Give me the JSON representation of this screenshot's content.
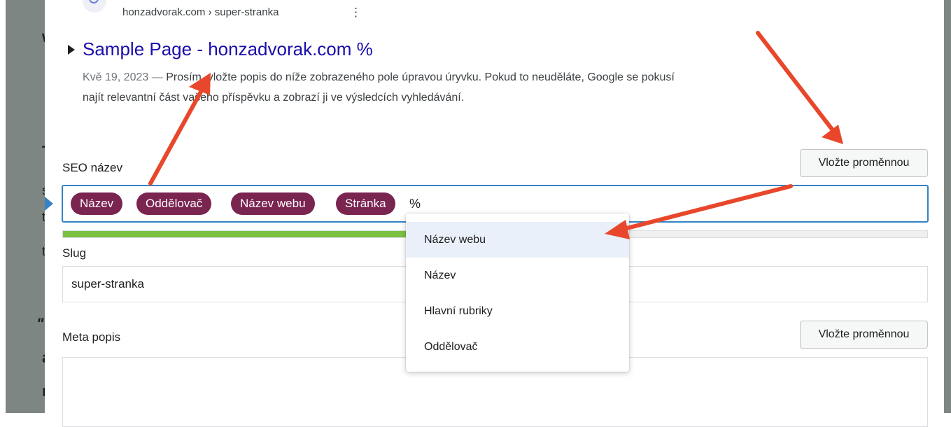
{
  "background_fragments": [
    "w",
    "T",
    "s",
    "t",
    "t",
    "\"",
    "a",
    "r"
  ],
  "preview": {
    "breadcrumb": "honzadvorak.com › super-stranka",
    "kebab": "⋮",
    "title": "Sample Page - honzadvorak.com %",
    "date": "Kvě 19, 2023 — ",
    "description": "Prosím, vložte popis do níže zobrazeného pole úpravou úryvku. Pokud to neuděláte, Google se pokusí najít relevantní část vašeho příspěvku a zobrazí ji ve výsledcích vyhledávání."
  },
  "seo_title": {
    "label": "SEO název",
    "insert_button": "Vložte proměnnou",
    "pills": [
      "Název",
      "Oddělovač",
      "Název webu",
      "Stránka"
    ],
    "trailing_text": "%",
    "progress": 0.4
  },
  "slug": {
    "label": "Slug",
    "value": "super-stranka"
  },
  "meta": {
    "label": "Meta popis",
    "insert_button": "Vložte proměnnou",
    "value": ""
  },
  "dropdown": {
    "items": [
      "Název webu",
      "Název",
      "Hlavní rubriky",
      "Oddělovač"
    ],
    "active_index": 0
  },
  "colors": {
    "pill": "#7a2450",
    "annotation_arrow": "#e8472b",
    "progress": "#7ac142",
    "focus": "#3582c4"
  }
}
